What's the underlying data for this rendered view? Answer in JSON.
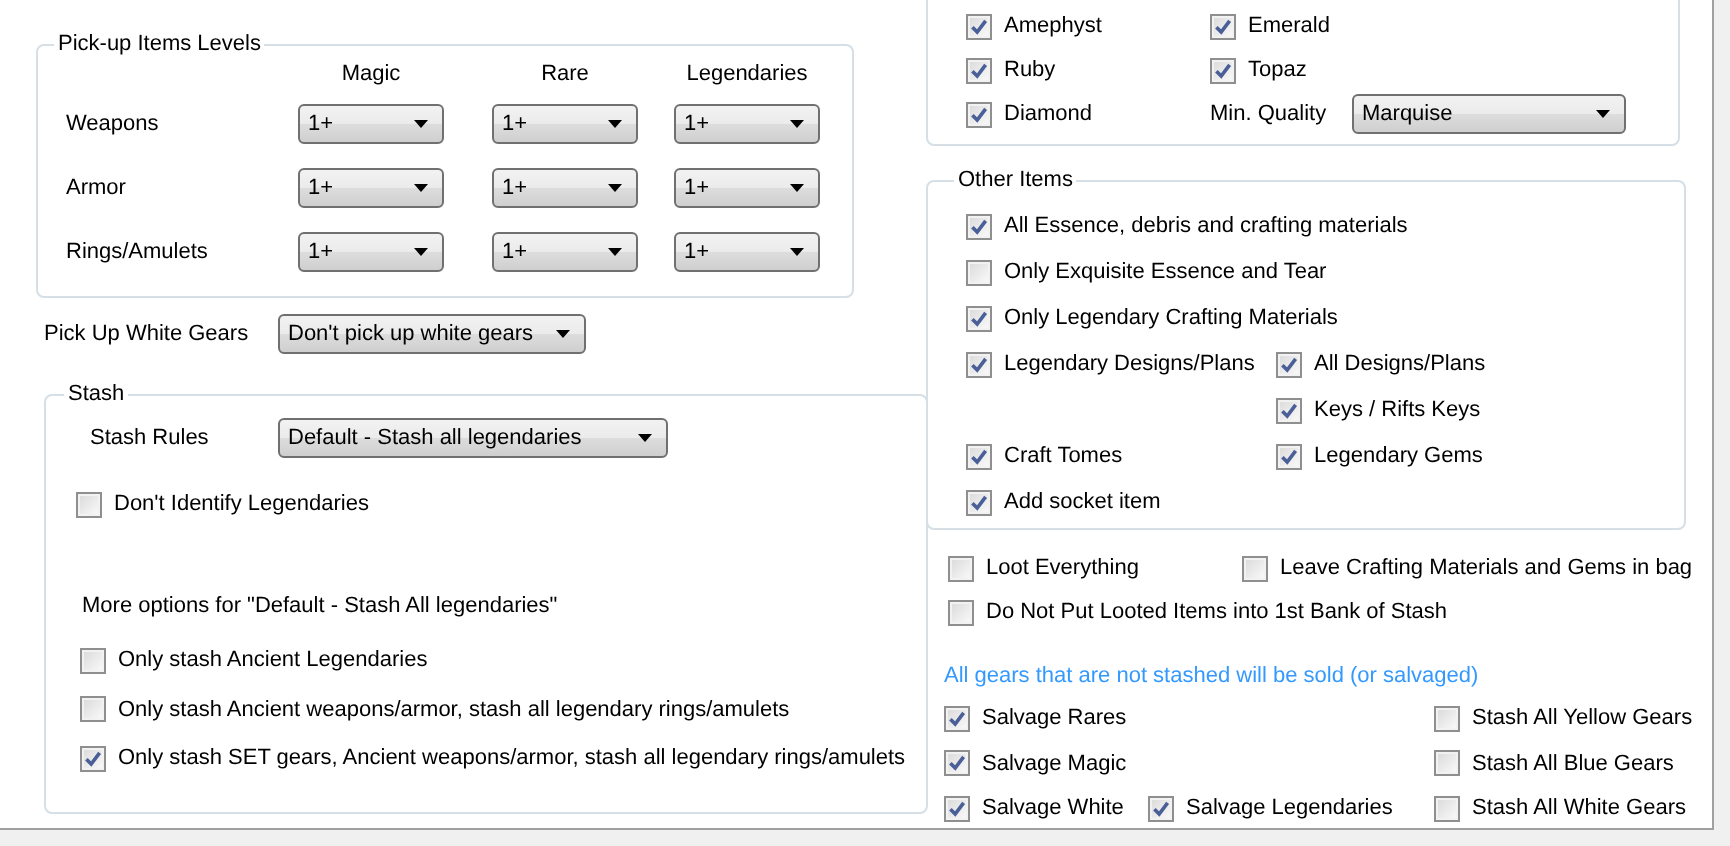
{
  "pickup_levels": {
    "title": "Pick-up Items Levels",
    "columns": [
      "Magic",
      "Rare",
      "Legendaries"
    ],
    "rows": [
      {
        "label": "Weapons",
        "values": [
          "1+",
          "1+",
          "1+"
        ]
      },
      {
        "label": "Armor",
        "values": [
          "1+",
          "1+",
          "1+"
        ]
      },
      {
        "label": "Rings/Amulets",
        "values": [
          "1+",
          "1+",
          "1+"
        ]
      }
    ]
  },
  "white_gears": {
    "label": "Pick Up White Gears",
    "value": "Don't pick up white gears"
  },
  "stash": {
    "title": "Stash",
    "rules_label": "Stash Rules",
    "rules_value": "Default - Stash all legendaries",
    "dont_identify": {
      "label": "Don't Identify Legendaries",
      "checked": false
    },
    "more_options_label": "More options for \"Default - Stash All legendaries\"",
    "options": [
      {
        "label": "Only stash Ancient Legendaries",
        "checked": false
      },
      {
        "label": "Only stash Ancient weapons/armor, stash all legendary rings/amulets",
        "checked": false
      },
      {
        "label": "Only stash SET gears, Ancient weapons/armor, stash all legendary rings/amulets",
        "checked": true
      }
    ]
  },
  "gems": {
    "rows": [
      {
        "left": {
          "label": "Amephyst",
          "checked": true
        },
        "right": {
          "label": "Emerald",
          "checked": true
        }
      },
      {
        "left": {
          "label": "Ruby",
          "checked": true
        },
        "right": {
          "label": "Topaz",
          "checked": true
        }
      },
      {
        "left": {
          "label": "Diamond",
          "checked": true
        }
      }
    ],
    "min_quality": {
      "label": "Min. Quality",
      "value": "Marquise"
    }
  },
  "other_items": {
    "title": "Other Items",
    "rows": [
      {
        "left": {
          "label": "All Essence, debris and crafting materials",
          "checked": true
        }
      },
      {
        "left": {
          "label": "Only Exquisite Essence and Tear",
          "checked": false
        }
      },
      {
        "left": {
          "label": "Only Legendary Crafting Materials",
          "checked": true
        }
      },
      {
        "left": {
          "label": "Legendary Designs/Plans",
          "checked": true
        },
        "right": {
          "label": "All Designs/Plans",
          "checked": true
        }
      },
      {
        "right": {
          "label": "Keys / Rifts Keys",
          "checked": true
        }
      },
      {
        "left": {
          "label": "Craft Tomes",
          "checked": true
        },
        "right": {
          "label": "Legendary Gems",
          "checked": true
        }
      },
      {
        "left": {
          "label": "Add socket item",
          "checked": true
        }
      }
    ]
  },
  "loot_options": {
    "rows": [
      {
        "left": {
          "label": "Loot Everything",
          "checked": false
        },
        "right": {
          "label": "Leave Crafting Materials and Gems in bag",
          "checked": false
        }
      },
      {
        "left": {
          "label": "Do Not Put Looted Items into 1st Bank of Stash",
          "checked": false
        }
      }
    ]
  },
  "sell_note": "All gears that are not stashed will be sold (or salvaged)",
  "salvage": {
    "rows": [
      {
        "left": {
          "label": "Salvage Rares",
          "checked": true
        },
        "right": {
          "label": "Stash All Yellow Gears",
          "checked": false
        }
      },
      {
        "left": {
          "label": "Salvage Magic",
          "checked": true
        },
        "right": {
          "label": "Stash All Blue Gears",
          "checked": false
        }
      },
      {
        "left": {
          "label": "Salvage White",
          "checked": true
        },
        "middle": {
          "label": "Salvage Legendaries",
          "checked": true
        },
        "right": {
          "label": "Stash All White Gears",
          "checked": false
        }
      }
    ]
  }
}
